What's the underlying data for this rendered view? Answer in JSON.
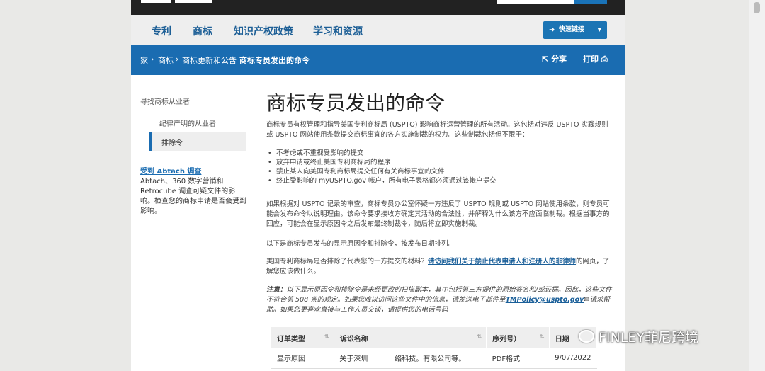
{
  "nav": {
    "items": [
      "专利",
      "商标",
      "知识产权政策",
      "学习和资源"
    ],
    "quick_links": "快速链接",
    "quick_icon": "arrow-icon"
  },
  "breadcrumb": {
    "items": [
      "家",
      "商标",
      "商标更新和公告",
      "商标专员发出的命令"
    ],
    "separator": "›",
    "share": "分享",
    "print": "打印"
  },
  "sidebar": {
    "heading": "寻找商标从业者",
    "items": [
      "纪律严明的从业者",
      "排除令"
    ],
    "active_index": 1,
    "survey_link": "受到 Abtach 调查",
    "survey_text": "Abtach、360 数字营销和 Retrocube 调查可疑文件的影响。检查您的商标申请是否会受到影响。"
  },
  "main": {
    "title": "商标专员发出的命令",
    "intro": "商标专员有权管理和指导美国专利商标局 (USPTO) 影响商标运营管理的所有活动。这包括对违反 USPTO 实践规则或 USPTO 网站使用条款提交商标事宜的各方实施制裁的权力。这些制裁包括但不限于：",
    "bullets": [
      "不考虑或不重视受影响的提交",
      "放弃申请或终止美国专利商标局的程序",
      "禁止某人向美国专利商标局提交任何有关商标事宜的文件",
      "终止受影响的 myUSPTO.gov 帐户，所有电子表格都必须通过该帐户提交"
    ],
    "p2": "如果根据对 USPTO 记录的审查，商标专员办公室怀疑一方违反了 USPTO 规则或 USPTO 网站使用条款，则专员可能会发布命令以说明理由。该命令要求接收方确定其活动的合法性，并解释为什么该方不应面临制裁。根据当事方的回应，可能会在显示原因令之后发布最终制裁令，随后将立即实施制裁。",
    "p3": "以下是商标专员发布的显示原因令和排除令，按发布日期排列。",
    "p4_pre": "美国专利商标局是否排除了代表您的一方提交的材料？",
    "p4_link": "请访问我们关于禁止代表申请人和注册人的非律师",
    "p4_post": "的网页，了解您应该做什么。",
    "note_label": "注意：",
    "note_text": "以下显示原因令和排除令是未经更改的扫描副本，其中包括第三方提供的原始签名和/或证据。因此，这些文件不符合第 508 条的规定。如果您难以访问这些文件中的信息，请发送电子邮件至",
    "note_email": "TMPolicy@uspto.gov",
    "note_text2": "请求帮助。如果您更喜欢直接与工作人员交谈，请提供您的电话号码"
  },
  "table": {
    "headers": [
      "订单类型",
      "诉讼名称",
      "序列号）",
      "日期"
    ],
    "rows": [
      [
        "显示原因",
        "关于深圳",
        "络科技。有限公司等。",
        "PDF格式",
        "9/07/2022"
      ]
    ]
  },
  "watermark": "FINLEY菲尼跨境"
}
